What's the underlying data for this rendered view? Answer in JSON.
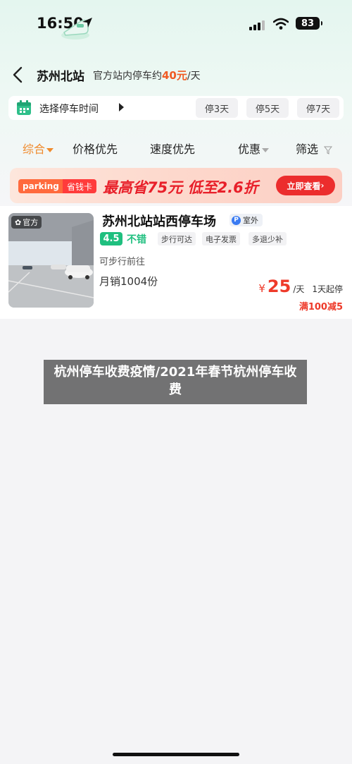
{
  "status_bar": {
    "time": "16:50",
    "battery": "83",
    "icons": [
      "location-arrow-icon",
      "train-icon",
      "signal-icon",
      "wifi-icon",
      "battery-icon"
    ]
  },
  "header": {
    "station": "苏州北站",
    "note_prefix": "官方站内停车约",
    "note_price": "40元",
    "note_suffix": "/天",
    "accent_color": "#f05a23"
  },
  "time_bar": {
    "label": "选择停车时间",
    "chips": [
      "停3天",
      "停5天",
      "停7天"
    ]
  },
  "sort": {
    "items": [
      "综合",
      "价格优先",
      "速度优先",
      "优惠",
      "筛选"
    ],
    "active_color": "#f08a2c"
  },
  "banner": {
    "tag1": "parking",
    "tag2": "省钱卡",
    "headline": "最高省75元 低至2.6折",
    "button": "立即查看"
  },
  "listing": {
    "official_badge": "官方",
    "name": "苏州北站站西停车场",
    "indoor_badge": "室外",
    "score": "4.5",
    "score_text": "不错",
    "tags": [
      "步行可达",
      "电子发票",
      "多退少补"
    ],
    "walk": "可步行前往",
    "sales": "月销1004份",
    "price_symbol": "¥",
    "price": "25",
    "price_unit": "/天",
    "min_days": "1天起停",
    "discount": "满100减5",
    "accent_color": "#ee3a2a",
    "score_color": "#1fbf7f"
  },
  "overlay": {
    "text": "杭州停车收费疫情/2021年春节杭州停车收费"
  }
}
